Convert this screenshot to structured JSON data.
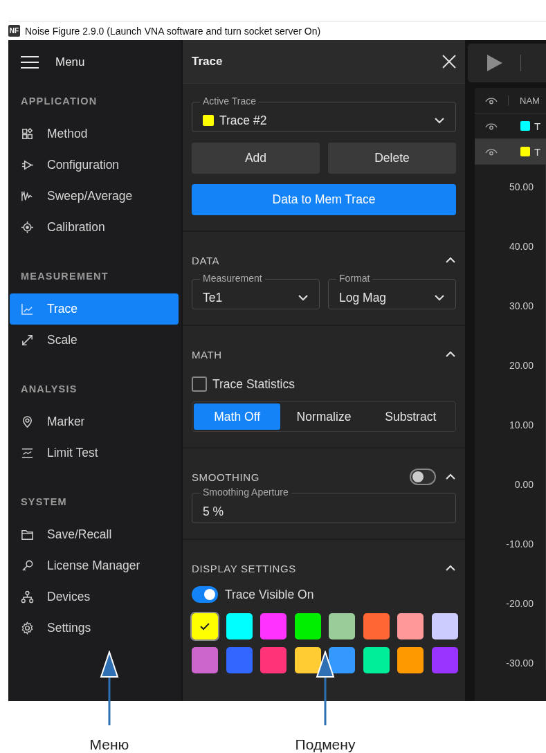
{
  "window": {
    "app_badge": "NF",
    "title": "Noise Figure 2.9.0 (Launch VNA software and turn socket server On)"
  },
  "menu": {
    "label": "Menu",
    "sections": [
      {
        "heading": "APPLICATION",
        "items": [
          {
            "label": "Method",
            "selected": false
          },
          {
            "label": "Configuration",
            "selected": false
          },
          {
            "label": "Sweep/Average",
            "selected": false
          },
          {
            "label": "Calibration",
            "selected": false
          }
        ]
      },
      {
        "heading": "MEASUREMENT",
        "items": [
          {
            "label": "Trace",
            "selected": true
          },
          {
            "label": "Scale",
            "selected": false
          }
        ]
      },
      {
        "heading": "ANALYSIS",
        "items": [
          {
            "label": "Marker",
            "selected": false
          },
          {
            "label": "Limit Test",
            "selected": false
          }
        ]
      },
      {
        "heading": "SYSTEM",
        "items": [
          {
            "label": "Save/Recall",
            "selected": false
          },
          {
            "label": "License Manager",
            "selected": false
          },
          {
            "label": "Devices",
            "selected": false
          },
          {
            "label": "Settings",
            "selected": false
          }
        ]
      }
    ]
  },
  "panel": {
    "title": "Trace",
    "active_trace": {
      "label": "Active Trace",
      "value": "Trace #2",
      "color": "#ffff00"
    },
    "buttons": [
      {
        "label": "Add",
        "kind": "secondary"
      },
      {
        "label": "Delete",
        "kind": "secondary"
      },
      {
        "label": "Data to Mem Trace",
        "kind": "primary"
      }
    ],
    "sections": [
      {
        "kind": "dropdowns",
        "heading": "DATA",
        "expanded": true,
        "fields": [
          {
            "label": "Measurement",
            "value": "Te1"
          },
          {
            "label": "Format",
            "value": "Log Mag"
          }
        ]
      },
      {
        "kind": "math",
        "heading": "MATH",
        "expanded": true,
        "checkbox": {
          "label": "Trace Statistics",
          "checked": false
        },
        "modes": [
          {
            "label": "Math Off",
            "selected": true
          },
          {
            "label": "Normalize",
            "selected": false
          },
          {
            "label": "Substract",
            "selected": false
          }
        ]
      },
      {
        "kind": "smoothing",
        "heading": "SMOOTHING",
        "expanded": true,
        "on": false,
        "field": {
          "label": "Smoothing Aperture",
          "value": "5 %"
        }
      },
      {
        "kind": "display",
        "heading": "DISPLAY SETTINGS",
        "expanded": true,
        "toggle": {
          "label": "Trace Visible On",
          "on": true
        },
        "swatches": [
          {
            "color": "#ffff00",
            "selected": true
          },
          {
            "color": "#00ffff",
            "selected": false
          },
          {
            "color": "#ff33ff",
            "selected": false
          },
          {
            "color": "#00ee00",
            "selected": false
          },
          {
            "color": "#99cc99",
            "selected": false
          },
          {
            "color": "#ff6633",
            "selected": false
          },
          {
            "color": "#ff9999",
            "selected": false
          },
          {
            "color": "#ccccff",
            "selected": false
          },
          {
            "color": "#cc66cc",
            "selected": false
          },
          {
            "color": "#3366ff",
            "selected": false
          },
          {
            "color": "#ff3377",
            "selected": false
          },
          {
            "color": "#ffcc33",
            "selected": false
          },
          {
            "color": "#3399ff",
            "selected": false
          },
          {
            "color": "#00ee99",
            "selected": false
          },
          {
            "color": "#ff9900",
            "selected": false
          },
          {
            "color": "#9933ff",
            "selected": false
          }
        ]
      }
    ]
  },
  "trace_table": {
    "columns": [
      "NAM"
    ],
    "rows": [
      {
        "name": "T",
        "color": "#00ffff",
        "selected": false
      },
      {
        "name": "T",
        "color": "#ffff00",
        "selected": true
      }
    ]
  },
  "y_axis": {
    "labels": [
      "50.00",
      "40.00",
      "30.00",
      "20.00",
      "10.00",
      "0.00",
      "-10.00",
      "-20.00",
      "-30.00"
    ]
  },
  "annotations": [
    {
      "label": "Меню"
    },
    {
      "label": "Подмену"
    }
  ]
}
